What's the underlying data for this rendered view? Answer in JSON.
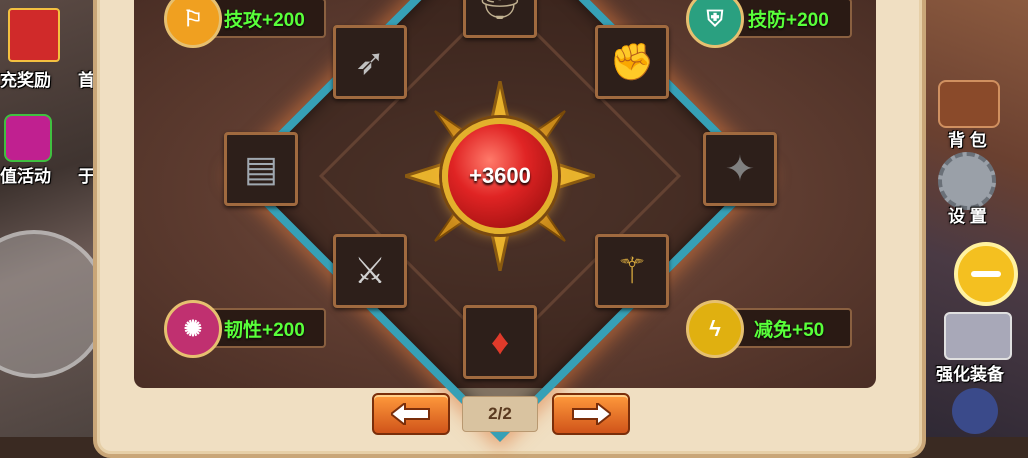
{
  "center": {
    "value": "+3600"
  },
  "badges": [
    {
      "label": "技攻+200",
      "color": "#f0a020",
      "icon": "sword-shield-icon"
    },
    {
      "label": "技防+200",
      "color": "#2aa080",
      "icon": "shield-icon"
    },
    {
      "label": "韧性+200",
      "color": "#c03070",
      "icon": "burst-icon"
    },
    {
      "label": "减免+50",
      "color": "#e0b010",
      "icon": "lightning-shield-icon"
    }
  ],
  "pager": {
    "text": "2/2"
  },
  "left_menu": {
    "item1": "充奖励",
    "item1b": "首",
    "item2": "值活动",
    "item2b": "于"
  },
  "right_menu": {
    "bag": "背 包",
    "settings": "设 置",
    "enhance": "强化装备"
  },
  "colors": {
    "accent_green": "#59ff3a",
    "ring": "#36a0b6",
    "orb": "#e02424"
  }
}
